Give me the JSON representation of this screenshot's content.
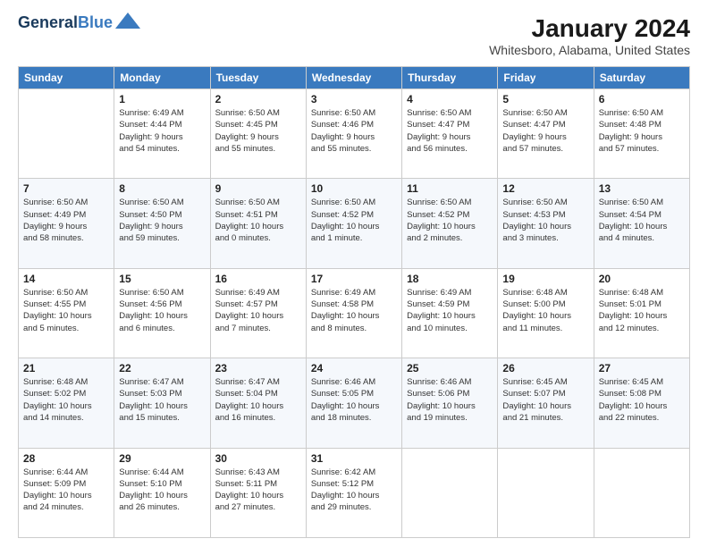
{
  "header": {
    "logo_line1": "General",
    "logo_line2": "Blue",
    "month": "January 2024",
    "location": "Whitesboro, Alabama, United States"
  },
  "weekdays": [
    "Sunday",
    "Monday",
    "Tuesday",
    "Wednesday",
    "Thursday",
    "Friday",
    "Saturday"
  ],
  "weeks": [
    [
      {
        "day": "",
        "info": ""
      },
      {
        "day": "1",
        "info": "Sunrise: 6:49 AM\nSunset: 4:44 PM\nDaylight: 9 hours\nand 54 minutes."
      },
      {
        "day": "2",
        "info": "Sunrise: 6:50 AM\nSunset: 4:45 PM\nDaylight: 9 hours\nand 55 minutes."
      },
      {
        "day": "3",
        "info": "Sunrise: 6:50 AM\nSunset: 4:46 PM\nDaylight: 9 hours\nand 55 minutes."
      },
      {
        "day": "4",
        "info": "Sunrise: 6:50 AM\nSunset: 4:47 PM\nDaylight: 9 hours\nand 56 minutes."
      },
      {
        "day": "5",
        "info": "Sunrise: 6:50 AM\nSunset: 4:47 PM\nDaylight: 9 hours\nand 57 minutes."
      },
      {
        "day": "6",
        "info": "Sunrise: 6:50 AM\nSunset: 4:48 PM\nDaylight: 9 hours\nand 57 minutes."
      }
    ],
    [
      {
        "day": "7",
        "info": "Sunrise: 6:50 AM\nSunset: 4:49 PM\nDaylight: 9 hours\nand 58 minutes."
      },
      {
        "day": "8",
        "info": "Sunrise: 6:50 AM\nSunset: 4:50 PM\nDaylight: 9 hours\nand 59 minutes."
      },
      {
        "day": "9",
        "info": "Sunrise: 6:50 AM\nSunset: 4:51 PM\nDaylight: 10 hours\nand 0 minutes."
      },
      {
        "day": "10",
        "info": "Sunrise: 6:50 AM\nSunset: 4:52 PM\nDaylight: 10 hours\nand 1 minute."
      },
      {
        "day": "11",
        "info": "Sunrise: 6:50 AM\nSunset: 4:52 PM\nDaylight: 10 hours\nand 2 minutes."
      },
      {
        "day": "12",
        "info": "Sunrise: 6:50 AM\nSunset: 4:53 PM\nDaylight: 10 hours\nand 3 minutes."
      },
      {
        "day": "13",
        "info": "Sunrise: 6:50 AM\nSunset: 4:54 PM\nDaylight: 10 hours\nand 4 minutes."
      }
    ],
    [
      {
        "day": "14",
        "info": "Sunrise: 6:50 AM\nSunset: 4:55 PM\nDaylight: 10 hours\nand 5 minutes."
      },
      {
        "day": "15",
        "info": "Sunrise: 6:50 AM\nSunset: 4:56 PM\nDaylight: 10 hours\nand 6 minutes."
      },
      {
        "day": "16",
        "info": "Sunrise: 6:49 AM\nSunset: 4:57 PM\nDaylight: 10 hours\nand 7 minutes."
      },
      {
        "day": "17",
        "info": "Sunrise: 6:49 AM\nSunset: 4:58 PM\nDaylight: 10 hours\nand 8 minutes."
      },
      {
        "day": "18",
        "info": "Sunrise: 6:49 AM\nSunset: 4:59 PM\nDaylight: 10 hours\nand 10 minutes."
      },
      {
        "day": "19",
        "info": "Sunrise: 6:48 AM\nSunset: 5:00 PM\nDaylight: 10 hours\nand 11 minutes."
      },
      {
        "day": "20",
        "info": "Sunrise: 6:48 AM\nSunset: 5:01 PM\nDaylight: 10 hours\nand 12 minutes."
      }
    ],
    [
      {
        "day": "21",
        "info": "Sunrise: 6:48 AM\nSunset: 5:02 PM\nDaylight: 10 hours\nand 14 minutes."
      },
      {
        "day": "22",
        "info": "Sunrise: 6:47 AM\nSunset: 5:03 PM\nDaylight: 10 hours\nand 15 minutes."
      },
      {
        "day": "23",
        "info": "Sunrise: 6:47 AM\nSunset: 5:04 PM\nDaylight: 10 hours\nand 16 minutes."
      },
      {
        "day": "24",
        "info": "Sunrise: 6:46 AM\nSunset: 5:05 PM\nDaylight: 10 hours\nand 18 minutes."
      },
      {
        "day": "25",
        "info": "Sunrise: 6:46 AM\nSunset: 5:06 PM\nDaylight: 10 hours\nand 19 minutes."
      },
      {
        "day": "26",
        "info": "Sunrise: 6:45 AM\nSunset: 5:07 PM\nDaylight: 10 hours\nand 21 minutes."
      },
      {
        "day": "27",
        "info": "Sunrise: 6:45 AM\nSunset: 5:08 PM\nDaylight: 10 hours\nand 22 minutes."
      }
    ],
    [
      {
        "day": "28",
        "info": "Sunrise: 6:44 AM\nSunset: 5:09 PM\nDaylight: 10 hours\nand 24 minutes."
      },
      {
        "day": "29",
        "info": "Sunrise: 6:44 AM\nSunset: 5:10 PM\nDaylight: 10 hours\nand 26 minutes."
      },
      {
        "day": "30",
        "info": "Sunrise: 6:43 AM\nSunset: 5:11 PM\nDaylight: 10 hours\nand 27 minutes."
      },
      {
        "day": "31",
        "info": "Sunrise: 6:42 AM\nSunset: 5:12 PM\nDaylight: 10 hours\nand 29 minutes."
      },
      {
        "day": "",
        "info": ""
      },
      {
        "day": "",
        "info": ""
      },
      {
        "day": "",
        "info": ""
      }
    ]
  ]
}
